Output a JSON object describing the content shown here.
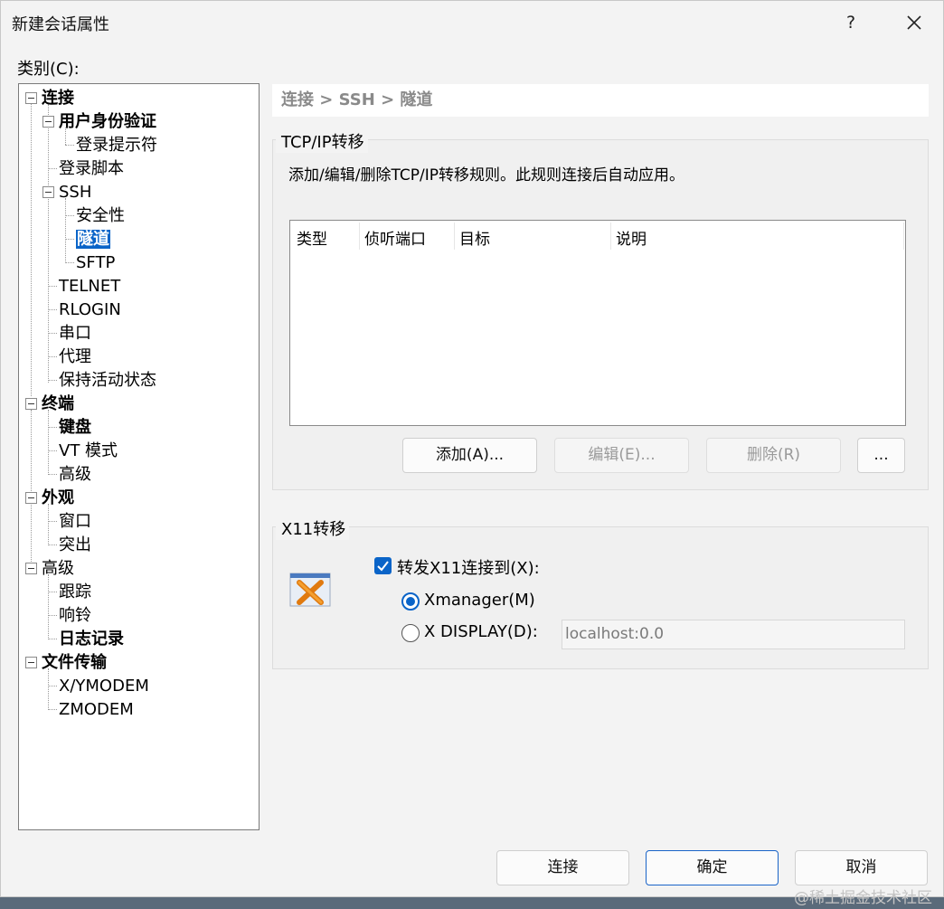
{
  "window": {
    "title": "新建会话属性",
    "help_glyph": "?"
  },
  "category_label": "类别(C):",
  "tree": {
    "items": [
      {
        "label": "连接",
        "bold": true
      },
      {
        "label": "用户身份验证",
        "bold": true
      },
      {
        "label": "登录提示符",
        "bold": false
      },
      {
        "label": "登录脚本",
        "bold": false
      },
      {
        "label": "SSH",
        "bold": false
      },
      {
        "label": "安全性",
        "bold": false
      },
      {
        "label": "隧道",
        "bold": true,
        "selected": true
      },
      {
        "label": "SFTP",
        "bold": false
      },
      {
        "label": "TELNET",
        "bold": false
      },
      {
        "label": "RLOGIN",
        "bold": false
      },
      {
        "label": "串口",
        "bold": false
      },
      {
        "label": "代理",
        "bold": false
      },
      {
        "label": "保持活动状态",
        "bold": false
      },
      {
        "label": "终端",
        "bold": true
      },
      {
        "label": "键盘",
        "bold": true
      },
      {
        "label": "VT 模式",
        "bold": false
      },
      {
        "label": "高级",
        "bold": false
      },
      {
        "label": "外观",
        "bold": true
      },
      {
        "label": "窗口",
        "bold": false
      },
      {
        "label": "突出",
        "bold": false
      },
      {
        "label": "高级",
        "bold": false
      },
      {
        "label": "跟踪",
        "bold": false
      },
      {
        "label": "响铃",
        "bold": false
      },
      {
        "label": "日志记录",
        "bold": true
      },
      {
        "label": "文件传输",
        "bold": true
      },
      {
        "label": "X/YMODEM",
        "bold": false
      },
      {
        "label": "ZMODEM",
        "bold": false
      }
    ]
  },
  "breadcrumb": "连接 > SSH > 隧道",
  "tcpip": {
    "group_title": "TCP/IP转移",
    "description": "添加/编辑/删除TCP/IP转移规则。此规则连接后自动应用。",
    "columns": [
      "类型",
      "侦听端口",
      "目标",
      "说明"
    ],
    "buttons": {
      "add": "添加(A)...",
      "edit": "编辑(E)...",
      "delete": "删除(R)",
      "more": "..."
    }
  },
  "x11": {
    "group_title": "X11转移",
    "forward_checkbox_label": "转发X11连接到(X):",
    "forward_checked": true,
    "radio_xmanager": "Xmanager(M)",
    "radio_display": "X DISPLAY(D):",
    "selected": "Xmanager(M)",
    "display_value": "localhost:0.0"
  },
  "footer": {
    "connect": "连接",
    "ok": "确定",
    "cancel": "取消"
  },
  "watermark": "@稀土掘金技术社区",
  "colors": {
    "accent": "#0a64c8",
    "dialog_bg": "#f3f3f3"
  }
}
